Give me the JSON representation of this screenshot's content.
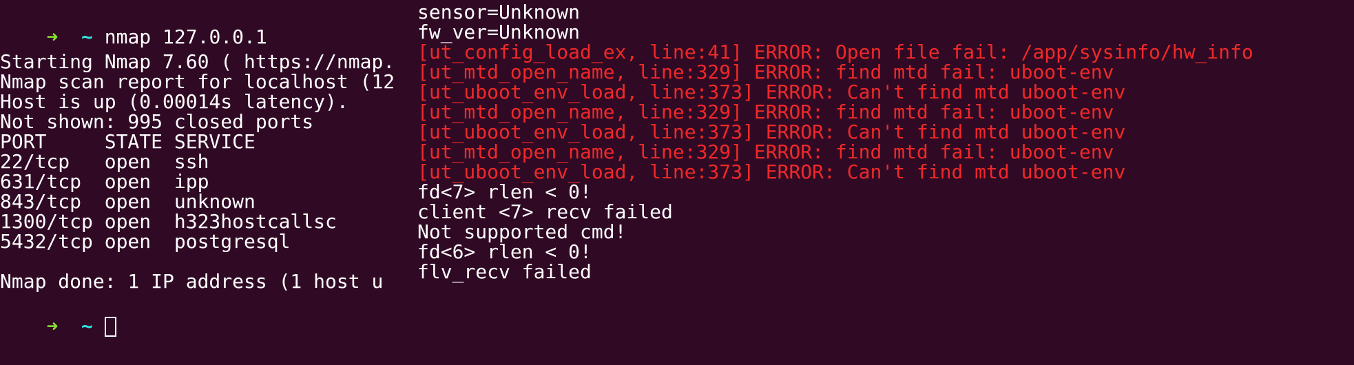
{
  "left_terminal": {
    "prompt_arrow": "➜",
    "prompt_dir": "~",
    "command": "nmap 127.0.0.1",
    "output": [
      "Starting Nmap 7.60 ( https://nmap.",
      "Nmap scan report for localhost (12",
      "Host is up (0.00014s latency).",
      "Not shown: 995 closed ports",
      "PORT     STATE SERVICE",
      "22/tcp   open  ssh",
      "631/tcp  open  ipp",
      "843/tcp  open  unknown",
      "1300/tcp open  h323hostcallsc",
      "5432/tcp open  postgresql",
      "",
      "Nmap done: 1 IP address (1 host u"
    ]
  },
  "right_terminal": {
    "lines": [
      {
        "text": "sensor=Unknown",
        "type": "normal"
      },
      {
        "text": "fw_ver=Unknown",
        "type": "normal"
      },
      {
        "text": "[ut_config_load_ex, line:41] ERROR: Open file fail: /app/sysinfo/hw_info",
        "type": "error"
      },
      {
        "text": "[ut_mtd_open_name, line:329] ERROR: find mtd fail: uboot-env",
        "type": "error"
      },
      {
        "text": "[ut_uboot_env_load, line:373] ERROR: Can't find mtd uboot-env",
        "type": "error"
      },
      {
        "text": "[ut_mtd_open_name, line:329] ERROR: find mtd fail: uboot-env",
        "type": "error"
      },
      {
        "text": "[ut_uboot_env_load, line:373] ERROR: Can't find mtd uboot-env",
        "type": "error"
      },
      {
        "text": "[ut_mtd_open_name, line:329] ERROR: find mtd fail: uboot-env",
        "type": "error"
      },
      {
        "text": "[ut_uboot_env_load, line:373] ERROR: Can't find mtd uboot-env",
        "type": "error"
      },
      {
        "text": "fd<7> rlen < 0!",
        "type": "normal"
      },
      {
        "text": "client <7> recv failed",
        "type": "normal"
      },
      {
        "text": "Not supported cmd!",
        "type": "normal"
      },
      {
        "text": "fd<6> rlen < 0!",
        "type": "normal"
      },
      {
        "text": "flv_recv failed",
        "type": "normal"
      }
    ]
  },
  "colors": {
    "background": "#300a24",
    "text": "#ffffff",
    "prompt_arrow": "#8ae234",
    "prompt_dir": "#34e2e2",
    "error": "#ef2929"
  }
}
